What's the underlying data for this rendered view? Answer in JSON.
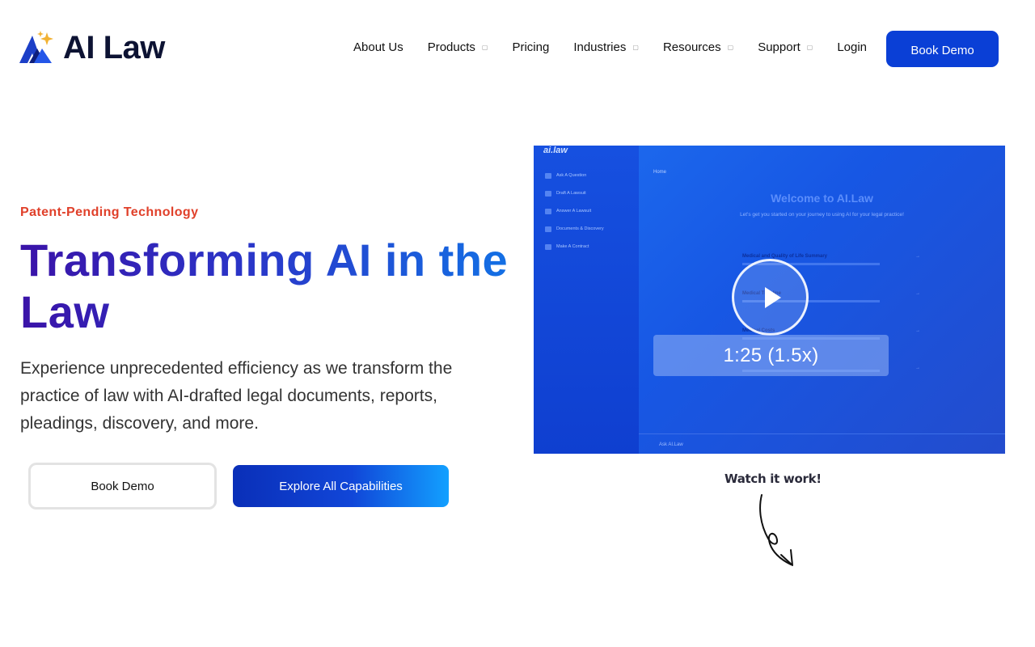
{
  "brand": {
    "name": "AI Law"
  },
  "nav": {
    "items": [
      {
        "label": "About Us",
        "dropdown": false
      },
      {
        "label": "Products",
        "dropdown": true
      },
      {
        "label": "Pricing",
        "dropdown": false
      },
      {
        "label": "Industries",
        "dropdown": true
      },
      {
        "label": "Resources",
        "dropdown": true
      },
      {
        "label": "Support",
        "dropdown": true
      },
      {
        "label": "Login",
        "dropdown": false
      }
    ],
    "cta": "Book Demo"
  },
  "hero": {
    "eyebrow": "Patent-Pending Technology",
    "headline": "Transforming AI in the Law",
    "description": "Experience unprecedented efficiency as we transform the practice of law with AI-drafted legal documents, reports, pleadings, discovery, and more.",
    "primary_button": "Book Demo",
    "secondary_button": "Explore All Capabilities"
  },
  "video": {
    "duration_label": "1:25 (1.5x)",
    "caption": "Watch it work!",
    "preview": {
      "brand": "ai.law",
      "menu": [
        "Ask A Question",
        "Draft A Lawsuit",
        "Answer A Lawsuit",
        "Documents & Discovery",
        "Make A Contract"
      ],
      "breadcrumb": "Home",
      "title": "Welcome to AI.Law",
      "subtitle": "Let's get you started on your journey to using AI for your legal practice!",
      "rows": [
        "Medical and Quality of Life Summary",
        "Medical Timeline",
        "Medical Costs",
        ""
      ],
      "ask_placeholder": "Ask AI.Law"
    }
  },
  "colors": {
    "brand_blue": "#0a3fd6",
    "eyebrow_red": "#e0402a",
    "headline_gradient_start": "#3a13a8",
    "headline_gradient_end": "#1273e6"
  },
  "icons": {
    "chevron": "chevron-down-icon",
    "play": "play-icon",
    "arrow": "curly-arrow-icon"
  }
}
